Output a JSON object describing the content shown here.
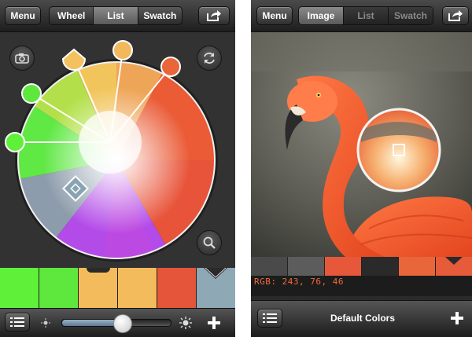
{
  "left_screen": {
    "menu_label": "Menu",
    "tabs": [
      {
        "label": "Wheel",
        "selected": false
      },
      {
        "label": "List",
        "selected": true
      },
      {
        "label": "Swatch",
        "selected": false
      }
    ],
    "share_icon": "share-arrow-icon",
    "camera_icon": "camera-icon",
    "refresh_icon": "refresh-icon",
    "zoom_icon": "magnifier-icon",
    "swatches": [
      "#5ff03a",
      "#5ee83e",
      "#f4bb5c",
      "#f4bb5c",
      "#e5553a",
      "#8fa8b6"
    ],
    "brightness_value": 0.55,
    "list_icon": "list-icon",
    "add_icon": "plus-icon"
  },
  "right_screen": {
    "menu_label": "Menu",
    "tabs": [
      {
        "label": "Image",
        "selected": true
      },
      {
        "label": "List",
        "selected": false
      },
      {
        "label": "Swatch",
        "selected": false
      }
    ],
    "share_icon": "share-arrow-icon",
    "palette": [
      "#4a4a4a",
      "#5c5c5c",
      "#e7573a",
      "#2a2a2a",
      "#e9653a",
      "#e65b3a"
    ],
    "rgb_readout": "RGB: 243, 76, 46",
    "footer_title": "Default Colors",
    "list_icon": "list-icon",
    "add_icon": "plus-icon"
  }
}
